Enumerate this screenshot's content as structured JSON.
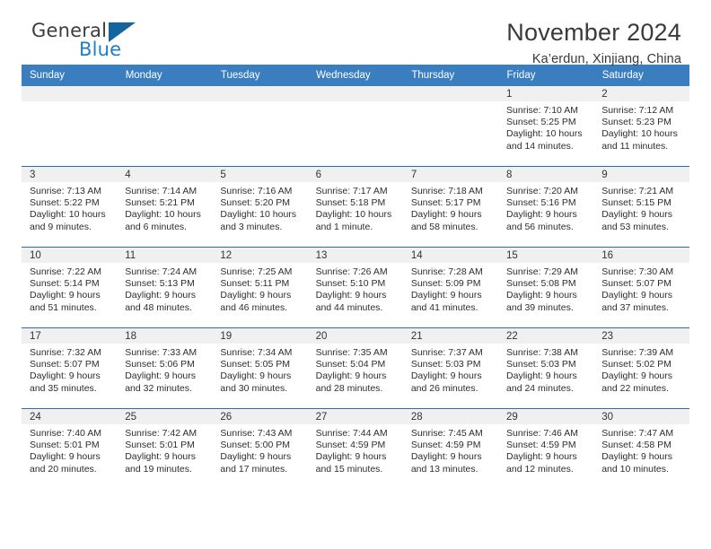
{
  "brand": {
    "name_part1": "General",
    "name_part2": "Blue"
  },
  "header": {
    "title": "November 2024",
    "location": "Ka’erdun, Xinjiang, China"
  },
  "weekday_headers": [
    "Sunday",
    "Monday",
    "Tuesday",
    "Wednesday",
    "Thursday",
    "Friday",
    "Saturday"
  ],
  "colors": {
    "header_blue": "#3a7ebf",
    "row_rule_blue": "#2f6da8",
    "daynum_gray": "#f0f0f0",
    "logo_blue": "#1464a0",
    "logo_text_blue": "#1f7fc4"
  },
  "weeks": [
    [
      {
        "day": "",
        "empty": true
      },
      {
        "day": "",
        "empty": true
      },
      {
        "day": "",
        "empty": true
      },
      {
        "day": "",
        "empty": true
      },
      {
        "day": "",
        "empty": true
      },
      {
        "day": "1",
        "sunrise": "Sunrise: 7:10 AM",
        "sunset": "Sunset: 5:25 PM",
        "daylight1": "Daylight: 10 hours",
        "daylight2": "and 14 minutes."
      },
      {
        "day": "2",
        "sunrise": "Sunrise: 7:12 AM",
        "sunset": "Sunset: 5:23 PM",
        "daylight1": "Daylight: 10 hours",
        "daylight2": "and 11 minutes."
      }
    ],
    [
      {
        "day": "3",
        "sunrise": "Sunrise: 7:13 AM",
        "sunset": "Sunset: 5:22 PM",
        "daylight1": "Daylight: 10 hours",
        "daylight2": "and 9 minutes."
      },
      {
        "day": "4",
        "sunrise": "Sunrise: 7:14 AM",
        "sunset": "Sunset: 5:21 PM",
        "daylight1": "Daylight: 10 hours",
        "daylight2": "and 6 minutes."
      },
      {
        "day": "5",
        "sunrise": "Sunrise: 7:16 AM",
        "sunset": "Sunset: 5:20 PM",
        "daylight1": "Daylight: 10 hours",
        "daylight2": "and 3 minutes."
      },
      {
        "day": "6",
        "sunrise": "Sunrise: 7:17 AM",
        "sunset": "Sunset: 5:18 PM",
        "daylight1": "Daylight: 10 hours",
        "daylight2": "and 1 minute."
      },
      {
        "day": "7",
        "sunrise": "Sunrise: 7:18 AM",
        "sunset": "Sunset: 5:17 PM",
        "daylight1": "Daylight: 9 hours",
        "daylight2": "and 58 minutes."
      },
      {
        "day": "8",
        "sunrise": "Sunrise: 7:20 AM",
        "sunset": "Sunset: 5:16 PM",
        "daylight1": "Daylight: 9 hours",
        "daylight2": "and 56 minutes."
      },
      {
        "day": "9",
        "sunrise": "Sunrise: 7:21 AM",
        "sunset": "Sunset: 5:15 PM",
        "daylight1": "Daylight: 9 hours",
        "daylight2": "and 53 minutes."
      }
    ],
    [
      {
        "day": "10",
        "sunrise": "Sunrise: 7:22 AM",
        "sunset": "Sunset: 5:14 PM",
        "daylight1": "Daylight: 9 hours",
        "daylight2": "and 51 minutes."
      },
      {
        "day": "11",
        "sunrise": "Sunrise: 7:24 AM",
        "sunset": "Sunset: 5:13 PM",
        "daylight1": "Daylight: 9 hours",
        "daylight2": "and 48 minutes."
      },
      {
        "day": "12",
        "sunrise": "Sunrise: 7:25 AM",
        "sunset": "Sunset: 5:11 PM",
        "daylight1": "Daylight: 9 hours",
        "daylight2": "and 46 minutes."
      },
      {
        "day": "13",
        "sunrise": "Sunrise: 7:26 AM",
        "sunset": "Sunset: 5:10 PM",
        "daylight1": "Daylight: 9 hours",
        "daylight2": "and 44 minutes."
      },
      {
        "day": "14",
        "sunrise": "Sunrise: 7:28 AM",
        "sunset": "Sunset: 5:09 PM",
        "daylight1": "Daylight: 9 hours",
        "daylight2": "and 41 minutes."
      },
      {
        "day": "15",
        "sunrise": "Sunrise: 7:29 AM",
        "sunset": "Sunset: 5:08 PM",
        "daylight1": "Daylight: 9 hours",
        "daylight2": "and 39 minutes."
      },
      {
        "day": "16",
        "sunrise": "Sunrise: 7:30 AM",
        "sunset": "Sunset: 5:07 PM",
        "daylight1": "Daylight: 9 hours",
        "daylight2": "and 37 minutes."
      }
    ],
    [
      {
        "day": "17",
        "sunrise": "Sunrise: 7:32 AM",
        "sunset": "Sunset: 5:07 PM",
        "daylight1": "Daylight: 9 hours",
        "daylight2": "and 35 minutes."
      },
      {
        "day": "18",
        "sunrise": "Sunrise: 7:33 AM",
        "sunset": "Sunset: 5:06 PM",
        "daylight1": "Daylight: 9 hours",
        "daylight2": "and 32 minutes."
      },
      {
        "day": "19",
        "sunrise": "Sunrise: 7:34 AM",
        "sunset": "Sunset: 5:05 PM",
        "daylight1": "Daylight: 9 hours",
        "daylight2": "and 30 minutes."
      },
      {
        "day": "20",
        "sunrise": "Sunrise: 7:35 AM",
        "sunset": "Sunset: 5:04 PM",
        "daylight1": "Daylight: 9 hours",
        "daylight2": "and 28 minutes."
      },
      {
        "day": "21",
        "sunrise": "Sunrise: 7:37 AM",
        "sunset": "Sunset: 5:03 PM",
        "daylight1": "Daylight: 9 hours",
        "daylight2": "and 26 minutes."
      },
      {
        "day": "22",
        "sunrise": "Sunrise: 7:38 AM",
        "sunset": "Sunset: 5:03 PM",
        "daylight1": "Daylight: 9 hours",
        "daylight2": "and 24 minutes."
      },
      {
        "day": "23",
        "sunrise": "Sunrise: 7:39 AM",
        "sunset": "Sunset: 5:02 PM",
        "daylight1": "Daylight: 9 hours",
        "daylight2": "and 22 minutes."
      }
    ],
    [
      {
        "day": "24",
        "sunrise": "Sunrise: 7:40 AM",
        "sunset": "Sunset: 5:01 PM",
        "daylight1": "Daylight: 9 hours",
        "daylight2": "and 20 minutes."
      },
      {
        "day": "25",
        "sunrise": "Sunrise: 7:42 AM",
        "sunset": "Sunset: 5:01 PM",
        "daylight1": "Daylight: 9 hours",
        "daylight2": "and 19 minutes."
      },
      {
        "day": "26",
        "sunrise": "Sunrise: 7:43 AM",
        "sunset": "Sunset: 5:00 PM",
        "daylight1": "Daylight: 9 hours",
        "daylight2": "and 17 minutes."
      },
      {
        "day": "27",
        "sunrise": "Sunrise: 7:44 AM",
        "sunset": "Sunset: 4:59 PM",
        "daylight1": "Daylight: 9 hours",
        "daylight2": "and 15 minutes."
      },
      {
        "day": "28",
        "sunrise": "Sunrise: 7:45 AM",
        "sunset": "Sunset: 4:59 PM",
        "daylight1": "Daylight: 9 hours",
        "daylight2": "and 13 minutes."
      },
      {
        "day": "29",
        "sunrise": "Sunrise: 7:46 AM",
        "sunset": "Sunset: 4:59 PM",
        "daylight1": "Daylight: 9 hours",
        "daylight2": "and 12 minutes."
      },
      {
        "day": "30",
        "sunrise": "Sunrise: 7:47 AM",
        "sunset": "Sunset: 4:58 PM",
        "daylight1": "Daylight: 9 hours",
        "daylight2": "and 10 minutes."
      }
    ]
  ]
}
